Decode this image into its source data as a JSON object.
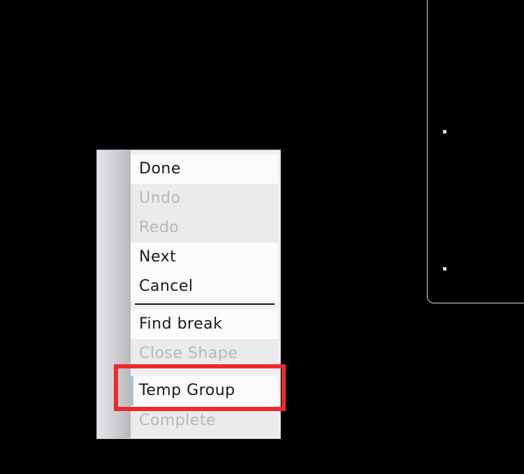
{
  "colors": {
    "background": "#000000",
    "menu_background": "#f0eff2",
    "enabled_text": "#1a1a1a",
    "disabled_text": "#b7b7ba",
    "highlight": "#ee2b2b",
    "canvas_outline": "#d8d8d8"
  },
  "context_menu": {
    "items": [
      {
        "label": "Done",
        "enabled": true
      },
      {
        "label": "Undo",
        "enabled": false
      },
      {
        "label": "Redo",
        "enabled": false
      },
      {
        "label": "Next",
        "enabled": true
      },
      {
        "label": "Cancel",
        "enabled": true
      },
      {
        "label": "Find break",
        "enabled": true
      },
      {
        "label": "Close Shape",
        "enabled": false
      },
      {
        "label": "Temp Group",
        "enabled": true,
        "highlighted": true
      },
      {
        "label": "Complete",
        "enabled": false
      }
    ]
  }
}
